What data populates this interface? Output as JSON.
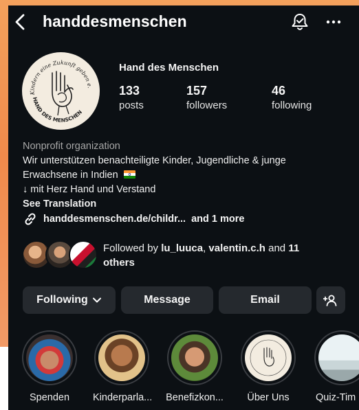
{
  "header": {
    "username": "handdesmenschen",
    "icons": [
      "chevron-left-icon",
      "bell-icon",
      "more-icon"
    ]
  },
  "profile": {
    "display_name": "Hand des Menschen",
    "stats": [
      {
        "value": "133",
        "label": "posts"
      },
      {
        "value": "157",
        "label": "followers"
      },
      {
        "value": "46",
        "label": "following"
      }
    ],
    "avatar_text": {
      "top": "Kindern eine Zukunft geben e.V.",
      "bottom": "HAND DES MENSCHEN"
    }
  },
  "bio": {
    "category": "Nonprofit organization",
    "line1": "Wir unterstützen benachteiligte Kinder, Jugendliche & junge",
    "line2": "Erwachsene in Indien",
    "line3": "↓ mit Herz Hand und Verstand",
    "see_translation": "See Translation",
    "link": "handdesmenschen.de/childr...",
    "more": "and 1 more"
  },
  "followed_by": {
    "prefix": "Followed by ",
    "user1": "lu_luuca",
    "sep": ", ",
    "user2": "valentin.c.h",
    "mid": " and ",
    "count": "11",
    "suffix": "others"
  },
  "actions": {
    "following": "Following",
    "message": "Message",
    "email": "Email"
  },
  "highlights": [
    {
      "label": "Spenden"
    },
    {
      "label": "Kinderparla..."
    },
    {
      "label": "Benefizkon..."
    },
    {
      "label": "Über Uns"
    },
    {
      "label": "Quiz-Tim"
    }
  ],
  "colors": {
    "background": "#0c1014",
    "button": "#25292e",
    "muted_text": "#a8a8a8",
    "backdrop": "#f08a4b"
  }
}
